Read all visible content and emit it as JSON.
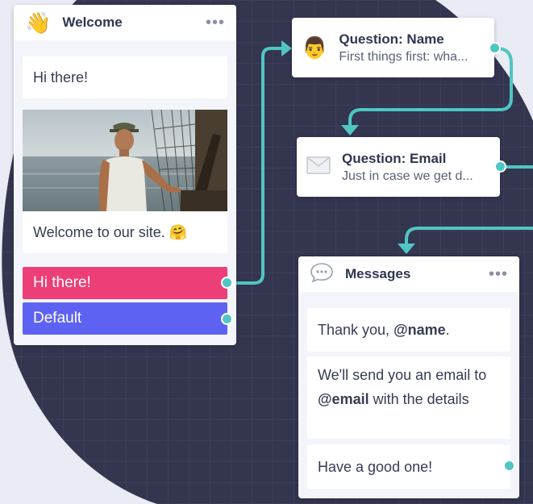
{
  "welcome": {
    "title": "Welcome",
    "icon": "waving-hand-icon",
    "menu_label": "•••",
    "messages": [
      "Hi there!",
      "Welcome to our site. 🤗"
    ],
    "buttons": [
      {
        "label": "Hi there!",
        "color": "#ec3f77"
      },
      {
        "label": "Default",
        "color": "#5e62f2"
      }
    ]
  },
  "question_name": {
    "title": "Question: Name",
    "subtitle": "First things first: wha...",
    "icon": "person-icon"
  },
  "question_email": {
    "title": "Question: Email",
    "subtitle": "Just in case we get d...",
    "icon": "envelope-icon"
  },
  "messages_node": {
    "title": "Messages",
    "icon": "speech-bubble-icon",
    "menu_label": "•••",
    "messages": [
      {
        "pre": "Thank you, ",
        "bold": "@name",
        "post": "."
      },
      {
        "pre": "We'll send you an email to ",
        "bold": "@email",
        "post": " with the details"
      },
      {
        "pre": "Have a good one!",
        "bold": "",
        "post": ""
      }
    ]
  },
  "colors": {
    "background": "#e9ebf5",
    "blob": "#34354f",
    "connector": "#4fc6c3",
    "accent_pink": "#ec3f77",
    "accent_purple": "#5e62f2"
  }
}
